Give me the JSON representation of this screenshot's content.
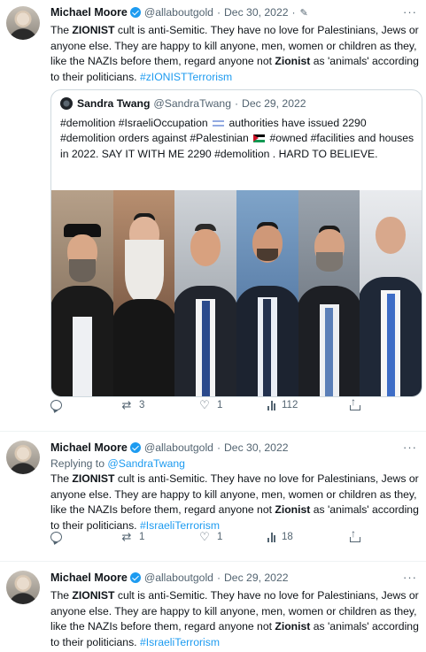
{
  "tweets": [
    {
      "name": "Michael Moore",
      "handle": "@allaboutgold",
      "sep": "·",
      "date": "Dec 30, 2022",
      "edited_sep": "·",
      "text_parts": [
        "The ",
        "ZIONIST",
        " cult is anti-Semitic. They have no love for Palestinians, Jews or anyone else. They are happy to kill anyone, men, women or children as they, like the NAZIs before them, regard anyone not ",
        "Zionist",
        " as 'animals' according to their politicians. "
      ],
      "hashtag": "#zIONISTTerrorism",
      "quote": {
        "name": "Sandra Twang",
        "handle": "@SandraTwang",
        "sep": "·",
        "date": "Dec 29, 2022",
        "text_a": "#demolition #IsraeliOccupation",
        "text_b": "authorities have issued 2290 #demolition orders against #Palestinian",
        "text_c": "#owned #facilities and houses in 2022. SAY IT WITH ME  2290 #demolition . HARD TO BELIEVE."
      },
      "reply_count": "",
      "retweet_count": "3",
      "like_count": "1",
      "view_count": "112"
    },
    {
      "name": "Michael Moore",
      "handle": "@allaboutgold",
      "sep": "·",
      "date": "Dec 30, 2022",
      "replying_prefix": "Replying to ",
      "replying_to": "@SandraTwang",
      "text_parts": [
        "The ",
        "ZIONIST",
        " cult is anti-Semitic. They have no love for Palestinians, Jews or anyone else. They are happy to kill anyone, men, women or children as they, like the NAZIs before them, regard anyone not ",
        "Zionist",
        " as 'animals' according to their politicians. "
      ],
      "hashtag": "#IsraeliTerrorism",
      "reply_count": "",
      "retweet_count": "1",
      "like_count": "1",
      "view_count": "18"
    },
    {
      "name": "Michael Moore",
      "handle": "@allaboutgold",
      "sep": "·",
      "date": "Dec 29, 2022",
      "text_parts": [
        "The ",
        "ZIONIST",
        " cult is anti-Semitic. They have no love for Palestinians, Jews or anyone else. They are happy to kill anyone, men, women or children as they, like the NAZIs before them, regard anyone not ",
        "Zionist",
        " as 'animals' according to their politicians. "
      ],
      "hashtag": "#IsraeliTerrorism"
    }
  ],
  "icons": {
    "more": "more-icon",
    "edit": "edit-icon",
    "verified": "verified-badge-icon",
    "retweet_glyph": "⇄",
    "like_glyph": "♡"
  },
  "colors": {
    "link": "#1d9bf0",
    "muted": "#536471",
    "verified": "#1d9bf0"
  }
}
